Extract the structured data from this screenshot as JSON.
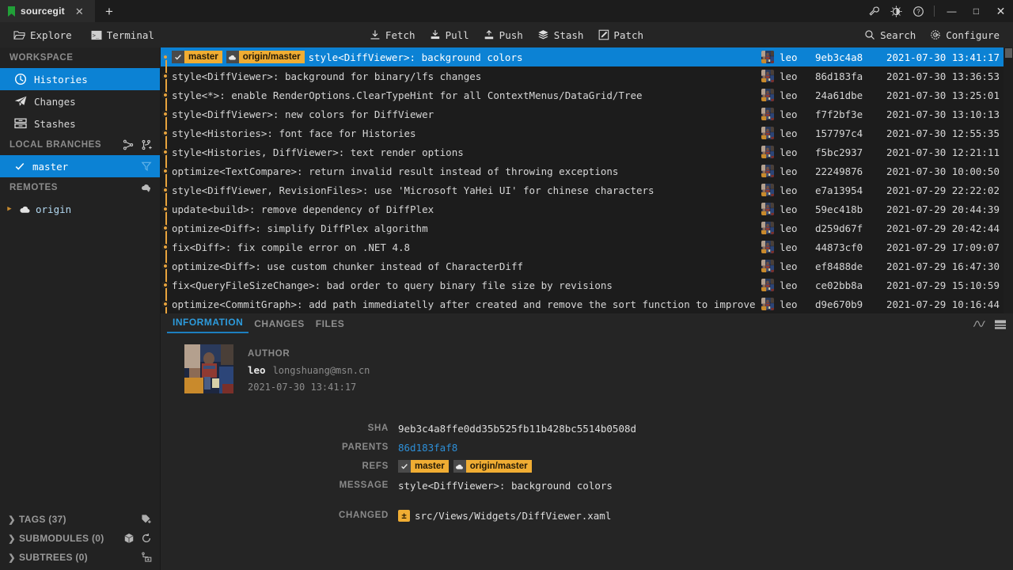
{
  "window": {
    "tab_title": "sourcegit",
    "tab_close": "✕",
    "new_tab": "+",
    "tools": [
      "wrench-icon",
      "theme-icon",
      "help-icon"
    ],
    "minimize": "—",
    "maximize": "□",
    "close": "✕"
  },
  "toolbar": {
    "left": [
      {
        "label": "Explore",
        "icon": "folder-open-icon"
      },
      {
        "label": "Terminal",
        "icon": "terminal-icon"
      }
    ],
    "center": [
      {
        "label": "Fetch",
        "icon": "download-icon"
      },
      {
        "label": "Pull",
        "icon": "pull-icon"
      },
      {
        "label": "Push",
        "icon": "upload-icon"
      },
      {
        "label": "Stash",
        "icon": "stack-icon"
      },
      {
        "label": "Patch",
        "icon": "patch-icon"
      }
    ],
    "right": [
      {
        "label": "Search",
        "icon": "search-icon"
      },
      {
        "label": "Configure",
        "icon": "gear-icon"
      }
    ]
  },
  "sidebar": {
    "groups": [
      {
        "title": "WORKSPACE",
        "actions": []
      },
      {
        "title": "LOCAL BRANCHES",
        "actions": [
          "branch-compare-icon",
          "new-branch-icon"
        ]
      },
      {
        "title": "REMOTES",
        "actions": [
          "add-remote-icon"
        ]
      }
    ],
    "workspace_items": [
      {
        "label": "Histories",
        "icon": "clock-icon",
        "selected": true
      },
      {
        "label": "Changes",
        "icon": "paper-plane-icon",
        "selected": false
      },
      {
        "label": "Stashes",
        "icon": "drawer-icon",
        "selected": false
      }
    ],
    "local_branches": [
      {
        "label": "master",
        "icon": "check-icon",
        "selected": true,
        "trailing": "filter-icon"
      }
    ],
    "remotes": [
      {
        "label": "origin",
        "icon": "cloud-icon",
        "caret": "▶"
      }
    ],
    "collapsed": [
      {
        "label": "TAGS (37)",
        "chev": "❯",
        "actions": [
          "add-tag-icon"
        ]
      },
      {
        "label": "SUBMODULES (0)",
        "chev": "❯",
        "actions": [
          "cube-icon",
          "refresh-icon"
        ]
      },
      {
        "label": "SUBTREES (0)",
        "chev": "❯",
        "actions": [
          "add-subtree-icon"
        ]
      }
    ]
  },
  "commit_list": {
    "columns": [
      "graph",
      "subject",
      "author",
      "sha",
      "time"
    ],
    "rows": [
      {
        "selected": true,
        "decorators": [
          {
            "icon": "check-icon",
            "name": "master"
          },
          {
            "icon": "cloud-icon",
            "name": "origin/master"
          }
        ],
        "subject": "style<DiffViewer>: background colors",
        "author": "leo",
        "sha": "9eb3c4a8",
        "time": "2021-07-30 13:41:17"
      },
      {
        "selected": false,
        "decorators": [],
        "subject": "style<DiffViewer>: background for binary/lfs changes",
        "author": "leo",
        "sha": "86d183fa",
        "time": "2021-07-30 13:36:53"
      },
      {
        "selected": false,
        "decorators": [],
        "subject": "style<*>: enable RenderOptions.ClearTypeHint for all ContextMenus/DataGrid/Tree",
        "author": "leo",
        "sha": "24a61dbe",
        "time": "2021-07-30 13:25:01"
      },
      {
        "selected": false,
        "decorators": [],
        "subject": "style<DiffViewer>: new colors for DiffViewer",
        "author": "leo",
        "sha": "f7f2bf3e",
        "time": "2021-07-30 13:10:13"
      },
      {
        "selected": false,
        "decorators": [],
        "subject": "style<Histories>: font face for Histories",
        "author": "leo",
        "sha": "157797c4",
        "time": "2021-07-30 12:55:35"
      },
      {
        "selected": false,
        "decorators": [],
        "subject": "style<Histories, DiffViewer>: text render options",
        "author": "leo",
        "sha": "f5bc2937",
        "time": "2021-07-30 12:21:11"
      },
      {
        "selected": false,
        "decorators": [],
        "subject": "optimize<TextCompare>: return invalid result instead of throwing exceptions",
        "author": "leo",
        "sha": "22249876",
        "time": "2021-07-30 10:00:50"
      },
      {
        "selected": false,
        "decorators": [],
        "subject": "style<DiffViewer, RevisionFiles>: use 'Microsoft YaHei UI' for chinese characters",
        "author": "leo",
        "sha": "e7a13954",
        "time": "2021-07-29 22:22:02"
      },
      {
        "selected": false,
        "decorators": [],
        "subject": "update<build>: remove dependency of DiffPlex",
        "author": "leo",
        "sha": "59ec418b",
        "time": "2021-07-29 20:44:39"
      },
      {
        "selected": false,
        "decorators": [],
        "subject": "optimize<Diff>: simplify DiffPlex algorithm",
        "author": "leo",
        "sha": "d259d67f",
        "time": "2021-07-29 20:42:44"
      },
      {
        "selected": false,
        "decorators": [],
        "subject": "fix<Diff>: fix compile error on .NET 4.8",
        "author": "leo",
        "sha": "44873cf0",
        "time": "2021-07-29 17:09:07"
      },
      {
        "selected": false,
        "decorators": [],
        "subject": "optimize<Diff>: use custom chunker instead of CharacterDiff",
        "author": "leo",
        "sha": "ef8488de",
        "time": "2021-07-29 16:47:30"
      },
      {
        "selected": false,
        "decorators": [],
        "subject": "fix<QueryFileSizeChange>: bad order to query binary file size by revisions",
        "author": "leo",
        "sha": "ce02bb8a",
        "time": "2021-07-29 15:10:59"
      },
      {
        "selected": false,
        "decorators": [],
        "subject": "optimize<CommitGraph>: add path immediatelly after created and remove the sort function to improve performance",
        "author": "leo",
        "sha": "d9e670b9",
        "time": "2021-07-29 10:16:44"
      }
    ]
  },
  "detail": {
    "tabs": [
      {
        "label": "INFORMATION",
        "active": true
      },
      {
        "label": "CHANGES",
        "active": false
      },
      {
        "label": "FILES",
        "active": false
      }
    ],
    "tools": [
      "graph-wave-icon",
      "layout-split-icon"
    ],
    "author": {
      "label": "AUTHOR",
      "name": "leo",
      "email": "longshuang@msn.cn",
      "time": "2021-07-30 13:41:17"
    },
    "fields": {
      "sha_label": "SHA",
      "sha_value": "9eb3c4a8ffe0dd35b525fb11b428bc5514b0508d",
      "parents_label": "PARENTS",
      "parents_value": "86d183faf8",
      "refs_label": "REFS",
      "refs": [
        {
          "icon": "check-icon",
          "name": "master"
        },
        {
          "icon": "cloud-icon",
          "name": "origin/master"
        }
      ],
      "message_label": "MESSAGE",
      "message_value": "style<DiffViewer>: background colors",
      "changed_label": "CHANGED",
      "changed": [
        {
          "badge": "±",
          "path": "src/Views/Widgets/DiffViewer.xaml"
        }
      ]
    }
  },
  "colors": {
    "accent": "#0c82d4",
    "branch_badge": "#f0ad33",
    "graph": "#e8a33d",
    "tab_active_text": "#2d9bdc",
    "link": "#2d8fd8"
  }
}
